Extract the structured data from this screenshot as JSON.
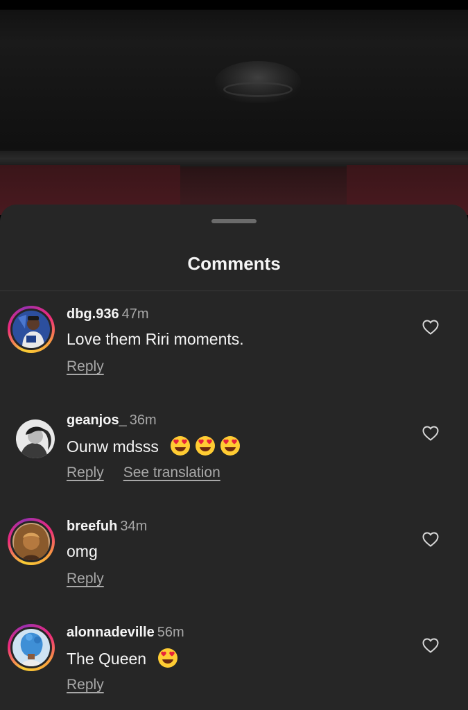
{
  "sheet": {
    "title": "Comments"
  },
  "comments": [
    {
      "username": "dbg.936",
      "time": "47m",
      "text": "Love them Riri moments.",
      "emojis": 0,
      "reply": "Reply",
      "translate": "",
      "avatar_ring": true,
      "avatar_color": "#2c4f9e"
    },
    {
      "username": "geanjos_",
      "time": "36m",
      "text": "Ounw mdsss",
      "emojis": 3,
      "reply": "Reply",
      "translate": "See translation",
      "avatar_ring": false,
      "avatar_color": "#d8d8d8"
    },
    {
      "username": "breefuh",
      "time": "34m",
      "text": "omg",
      "emojis": 0,
      "reply": "Reply",
      "translate": "",
      "avatar_ring": true,
      "avatar_color": "#b5793f"
    },
    {
      "username": "alonnadeville",
      "time": "56m",
      "text": "The Queen",
      "emojis": 1,
      "reply": "Reply",
      "translate": "",
      "avatar_ring": true,
      "avatar_color": "#3f8fd6"
    }
  ],
  "icons": {
    "heart": "heart-outline-icon",
    "emoji": "heart-eyes-emoji"
  },
  "colors": {
    "sheet_bg": "#262626",
    "text_primary": "#f5f5f5",
    "text_secondary": "#a8a8a8",
    "ring_start": "#f9ce34",
    "ring_mid": "#ee2a7b"
  }
}
